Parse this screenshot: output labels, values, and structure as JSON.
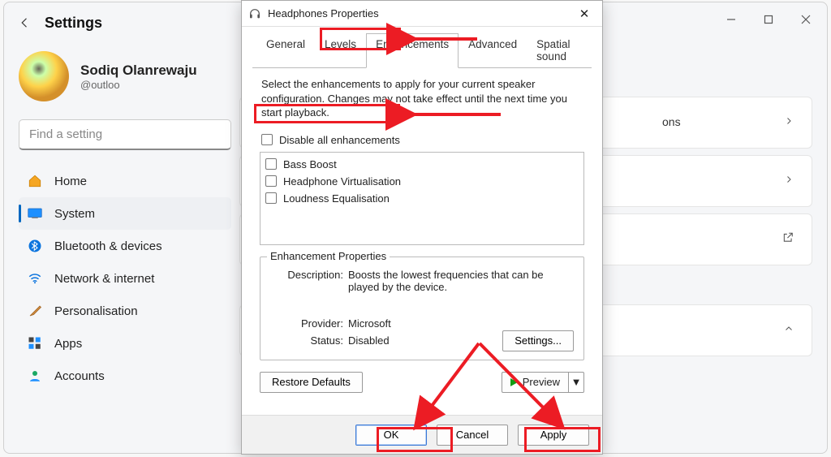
{
  "settings": {
    "title": "Settings",
    "profile": {
      "name": "Sodiq Olanrewaju",
      "email": "@outloo"
    },
    "search_placeholder": "Find a setting",
    "nav": [
      {
        "key": "home",
        "label": "Home"
      },
      {
        "key": "system",
        "label": "System"
      },
      {
        "key": "bluetooth",
        "label": "Bluetooth & devices"
      },
      {
        "key": "network",
        "label": "Network & internet"
      },
      {
        "key": "personalisation",
        "label": "Personalisation"
      },
      {
        "key": "apps",
        "label": "Apps"
      },
      {
        "key": "accounts",
        "label": "Accounts"
      }
    ],
    "card_label_fragment": "ons"
  },
  "dialog": {
    "title": "Headphones Properties",
    "tabs": {
      "general": "General",
      "levels": "Levels",
      "enhancements": "Enhancements",
      "advanced": "Advanced",
      "spatial": "Spatial sound"
    },
    "intro": "Select the enhancements to apply for your current speaker configuration. Changes may not take effect until the next time you start playback.",
    "disable_all": "Disable all enhancements",
    "enhancements": [
      "Bass Boost",
      "Headphone Virtualisation",
      "Loudness Equalisation"
    ],
    "props": {
      "title": "Enhancement Properties",
      "description_label": "Description:",
      "description_value": "Boosts the lowest frequencies that can be played by the device.",
      "provider_label": "Provider:",
      "provider_value": "Microsoft",
      "status_label": "Status:",
      "status_value": "Disabled",
      "settings_btn": "Settings..."
    },
    "restore": "Restore Defaults",
    "preview": "Preview",
    "footer": {
      "ok": "OK",
      "cancel": "Cancel",
      "apply": "Apply"
    }
  }
}
